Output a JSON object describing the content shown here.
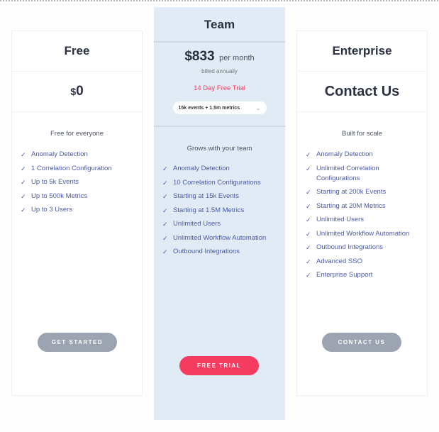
{
  "plans": {
    "free": {
      "name": "Free",
      "price_currency": "$",
      "price_amount": "0",
      "subtitle": "Free for everyone",
      "check_icon": "✓",
      "features": [
        "Anomaly Detection",
        "1 Correlation Configuration",
        "Up to 5k Events",
        "Up to 500k Metrics",
        "Up to 3 Users"
      ],
      "button_label": "GET STARTED"
    },
    "team": {
      "name": "Team",
      "price_amount": "$833",
      "price_period": "per month",
      "billing_note": "billed annually",
      "trial_note": "14 Day Free Trial",
      "tier_select": {
        "selected": "15k events + 1.5m metrics",
        "chevron_icon": "⌄"
      },
      "subtitle": "Grows with your team",
      "check_icon": "✓",
      "features": [
        "Anomaly Detection",
        "10 Correlation Configurations",
        "Starting at 15k Events",
        "Starting at 1.5M Metrics",
        "Unlimited Users",
        "Unlimited Workflow Automation",
        "Outbound Integrations"
      ],
      "button_label": "FREE TRIAL"
    },
    "enterprise": {
      "name": "Enterprise",
      "price_label": "Contact Us",
      "subtitle": "Built for scale",
      "check_icon": "✓",
      "features": [
        "Anomaly Detection",
        "Unlimited Correlation Configurations",
        "Starting at 200k Events",
        "Starting at 20M Metrics",
        "Unlimited Users",
        "Unlimited Workflow Automation",
        "Outbound Integrations",
        "Advanced SSO",
        "Enterprise Support"
      ],
      "button_label": "CONTACT US"
    }
  },
  "colors": {
    "accent_red": "#f53b5f",
    "trial_text": "#f4385f",
    "feature_text": "#4b5aaa",
    "team_background": "#e1ebf5",
    "button_gray": "#9ca3b1",
    "heading_text": "#2a3142"
  }
}
